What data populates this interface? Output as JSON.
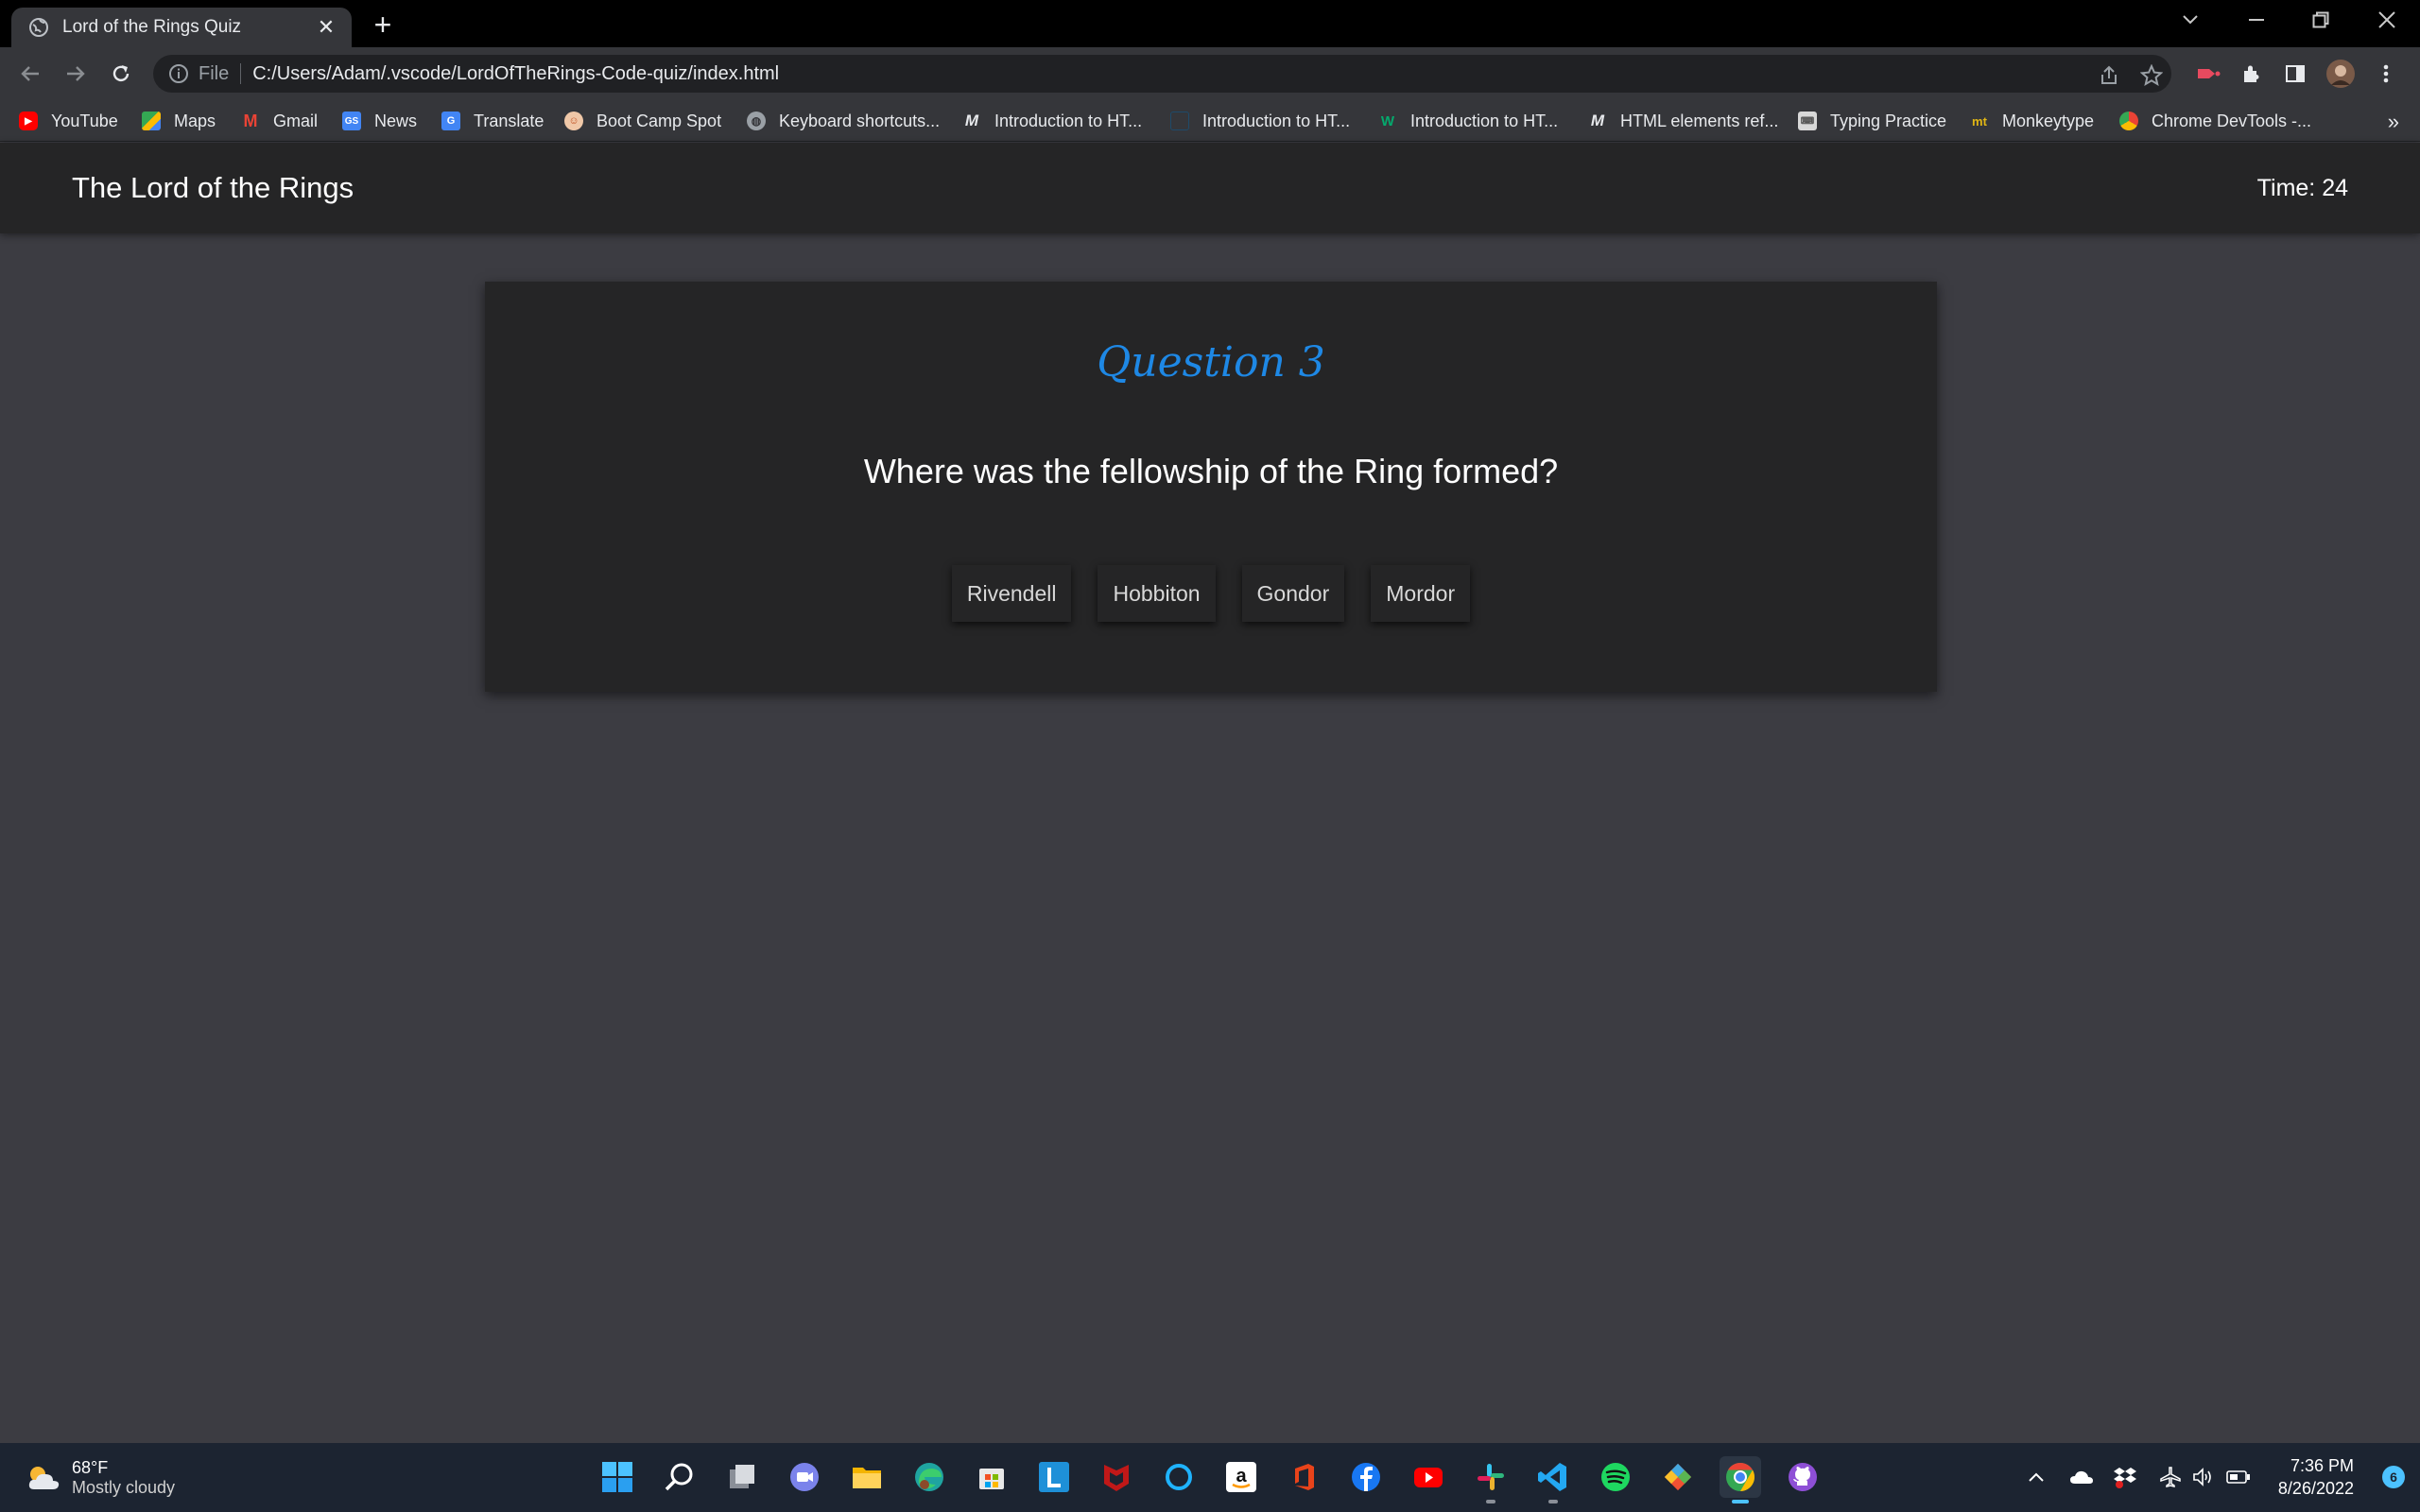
{
  "browser": {
    "tab_title": "Lord of the Rings Quiz",
    "url_scheme": "File",
    "url": "C:/Users/Adam/.vscode/LordOfTheRings-Code-quiz/index.html",
    "bookmarks": [
      {
        "label": "YouTube",
        "icon": "youtube-icon"
      },
      {
        "label": "Maps",
        "icon": "maps-icon"
      },
      {
        "label": "Gmail",
        "icon": "gmail-icon"
      },
      {
        "label": "News",
        "icon": "news-icon"
      },
      {
        "label": "Translate",
        "icon": "translate-icon"
      },
      {
        "label": "Boot Camp Spot",
        "icon": "bootcamp-icon"
      },
      {
        "label": "Keyboard shortcuts...",
        "icon": "globe-icon"
      },
      {
        "label": "Introduction to HT...",
        "icon": "mdn-icon"
      },
      {
        "label": "Introduction to HT...",
        "icon": "doc-icon"
      },
      {
        "label": "Introduction to HT...",
        "icon": "w3-icon"
      },
      {
        "label": "HTML elements ref...",
        "icon": "mdn-icon"
      },
      {
        "label": "Typing Practice",
        "icon": "typing-icon"
      },
      {
        "label": "Monkeytype",
        "icon": "monkeytype-icon"
      },
      {
        "label": "Chrome DevTools -...",
        "icon": "chrome-icon"
      }
    ],
    "more_bookmarks": "»"
  },
  "app": {
    "title": "The Lord of the Rings",
    "timer": "Time: 24"
  },
  "quiz": {
    "heading": "Question 3",
    "question": "Where was the fellowship of the Ring formed?",
    "answers": [
      "Rivendell",
      "Hobbiton",
      "Gondor",
      "Mordor"
    ]
  },
  "taskbar": {
    "weather_temp": "68°F",
    "weather_desc": "Mostly cloudy",
    "time": "7:36 PM",
    "date": "8/26/2022",
    "notifications": "6"
  },
  "colors": {
    "accent": "#1e88e5",
    "card": "#252526",
    "page_bg": "#3c3c42"
  }
}
